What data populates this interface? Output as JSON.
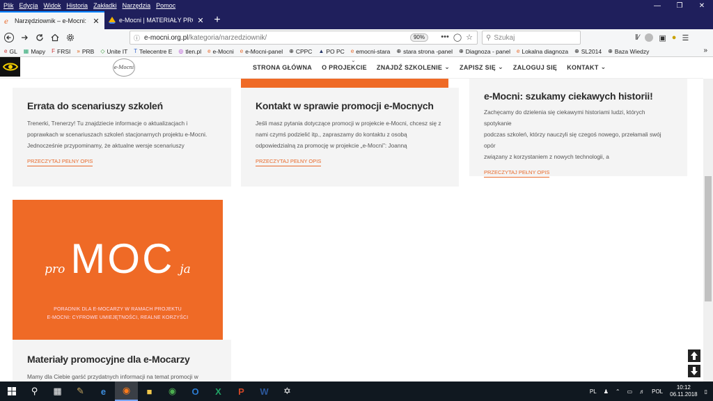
{
  "menubar": {
    "items": [
      "Plik",
      "Edycja",
      "Widok",
      "Historia",
      "Zakładki",
      "Narzędzia",
      "Pomoc"
    ]
  },
  "tabs": [
    {
      "label": "Narzędziownik – e-Mocni: cyfrowe",
      "active": true
    },
    {
      "label": "e-Mocni | MATERIAŁY PROMOCYJNE",
      "active": false
    }
  ],
  "urlbar": {
    "host": "e-mocni.org.pl",
    "path": "/kategoria/narzedziownik/",
    "zoom": "90%",
    "more": "•••"
  },
  "search": {
    "placeholder": "Szukaj"
  },
  "bookmarks": [
    {
      "label": "GL",
      "icon": "e"
    },
    {
      "label": "Mapy",
      "icon": "▦"
    },
    {
      "label": "FRSI",
      "icon": "F"
    },
    {
      "label": "PRB",
      "icon": "»"
    },
    {
      "label": "Unite IT",
      "icon": "◇"
    },
    {
      "label": "Telecentre E",
      "icon": "T"
    },
    {
      "label": "tlen.pl",
      "icon": "◎"
    },
    {
      "label": "e-Mocni",
      "icon": "e"
    },
    {
      "label": "e-Mocni-panel",
      "icon": "e"
    },
    {
      "label": "CPPC",
      "icon": "⊕"
    },
    {
      "label": "PO PC",
      "icon": "▲"
    },
    {
      "label": "emocni-stara",
      "icon": "e"
    },
    {
      "label": "stara strona -panel",
      "icon": "⊕"
    },
    {
      "label": "Diagnoza - panel",
      "icon": "⊕"
    },
    {
      "label": "Lokalna diagnoza",
      "icon": "e"
    },
    {
      "label": "SL2014",
      "icon": "⊕"
    },
    {
      "label": "Baza Wiedzy",
      "icon": "⊕"
    }
  ],
  "site": {
    "logo_text": "e-Mocni",
    "nav": [
      {
        "label": "STRONA GŁÓWNA",
        "dropdown": false
      },
      {
        "label": "O PROJEKCIE",
        "dropdown": false
      },
      {
        "label": "ZNAJDŹ SZKOLENIE",
        "dropdown": true
      },
      {
        "label": "ZAPISZ SIĘ",
        "dropdown": true
      },
      {
        "label": "ZALOGUJ SIĘ",
        "dropdown": false
      },
      {
        "label": "KONTAKT",
        "dropdown": true
      }
    ]
  },
  "cards": [
    {
      "title": "Errata do scenariuszy szkoleń",
      "lines": [
        "Trenerki, Trenerzy! Tu znajdziecie informacje o aktualizacjach i",
        "poprawkach w scenariuszach szkoleń stacjonarnych projektu e-Mocni.",
        "Jednocześnie przypominamy, że aktualne wersje scenariuszy"
      ],
      "more": "PRZECZYTAJ PEŁNY OPIS"
    },
    {
      "title": "Kontakt w sprawie promocji e-Mocnych",
      "lines": [
        "Jeśli masz pytania dotyczące promocji w projekcie e-Mocni, chcesz się z",
        "nami czymś podzielić itp., zapraszamy do kontaktu z osobą",
        "odpowiedzialną za promocję w projekcie „e-Mocni”: Joanną"
      ],
      "more": "PRZECZYTAJ PEŁNY OPIS"
    },
    {
      "title": "e-Mocni: szukamy ciekawych historii!",
      "lines": [
        "Zachęcamy do dzielenia się ciekawymi historiami ludzi, których spotykanie",
        "podczas szkoleń, którzy nauczyli się czegoś nowego, przełamali swój opór",
        "związany z korzystaniem z nowych technologii, a"
      ],
      "more": "PRZECZYTAJ PEŁNY OPIS"
    },
    {
      "title": "Materiały promocyjne dla e-Mocarzy",
      "lines": [
        "Mamy dla Ciebie garść przydatnych informacji na temat promocji w"
      ]
    }
  ],
  "promo": {
    "pro": "pro",
    "moc": "MOC",
    "ja": "ja",
    "sub1": "PORADNIK DLA E-MOCARZY W RAMACH PROJEKTU",
    "sub2": "E-MOCNI: CYFROWE UMIEJĘTNOŚCI, REALNE KORZYŚCI"
  },
  "taskbar": {
    "lang": "PL",
    "input_lang": "POL",
    "time": "10:12",
    "date": "06.11.2018"
  },
  "colors": {
    "accent": "#ef6a26",
    "titlebar": "#1f1f5c",
    "taskbar": "#101820"
  }
}
